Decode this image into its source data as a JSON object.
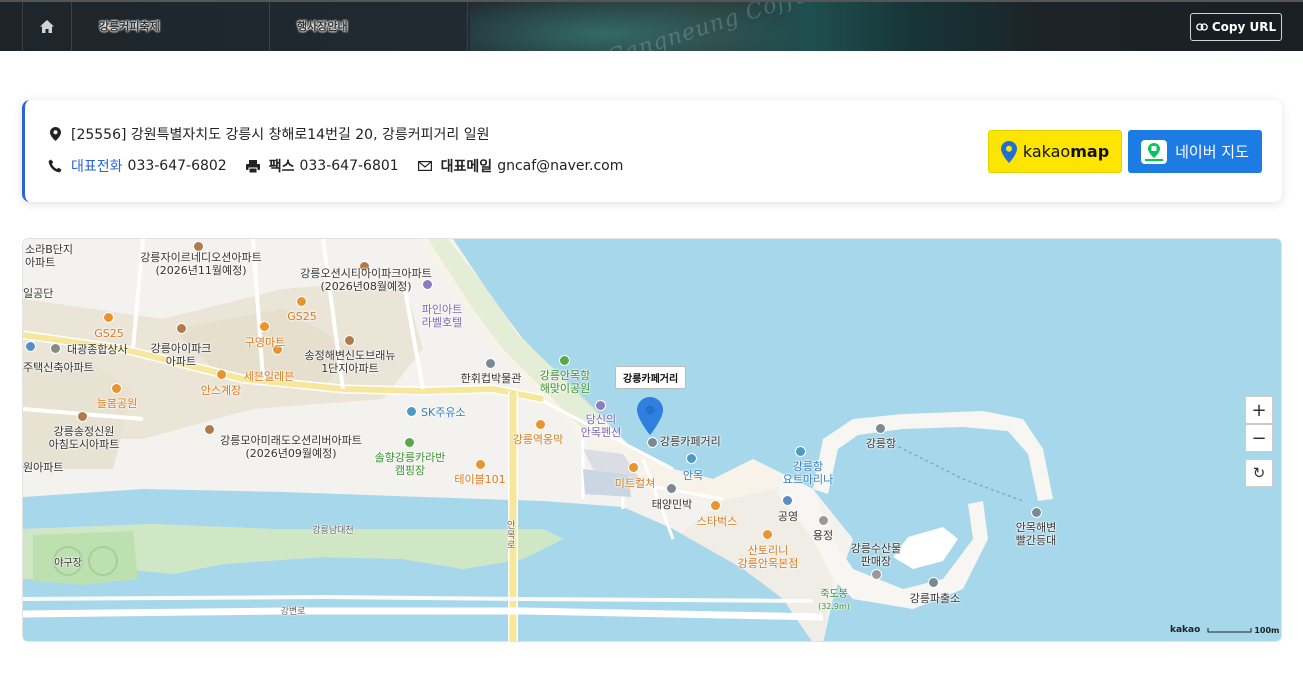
{
  "nav": {
    "festival_label": "강릉커피축제",
    "guide_label": "행사장안내",
    "copy_url_label": "Copy URL",
    "banner_text": "Gangneung Coffee Festival"
  },
  "info": {
    "address": "[25556] 강원특별자치도 강릉시 창해로14번길 20, 강릉커피거리 일원",
    "phone_label": "대표전화",
    "phone": "033-647-6802",
    "fax_label": "팩스",
    "fax": "033-647-6801",
    "email_label": "대표메일",
    "email": "gncaf@naver.com",
    "kakao_map_label_a": "kakao",
    "kakao_map_label_b": "map",
    "naver_map_label": "네이버 지도"
  },
  "map": {
    "marker_label": "강릉카페거리",
    "attribution": "kakao",
    "scale": "100m",
    "labels": {
      "sora": "소라B단지\n아파트",
      "ilgongdan": "일공단",
      "xi": "강릉자이르네디오션아파트\n(2026년11월예정)",
      "oceancity": "강릉오션시티아이파크아파트\n(2026년08월예정)",
      "pine": "파인아트\n라벨호텔",
      "gs25a": "GS25",
      "gs25b": "GS25",
      "daegwang": "대광종합상사",
      "ipark": "강릉아이파크\n아파트",
      "guyeong": "구영마트",
      "songjeong": "송정해변신도브래뉴\n1단지아파트",
      "jutaek": "주택신축아파트",
      "seben": "세븐일레븐",
      "anseu": "안스계장",
      "neulbom": "늘봄공원",
      "hanhwi": "한휘컵박물관",
      "haemaji": "강릉안목항\n해맞이공원",
      "dangsin": "당신의\n안목펜션",
      "sk": "SK주유소",
      "songjeongsin": "강릉송정신원\n아침도시아파트",
      "moamirae": "강릉모아미래도오션리버아파트\n(2026년09월예정)",
      "yeokmyeong": "강릉역옹막",
      "caravan": "솔향강릉카라반\n캠핑장",
      "table101": "테이블101",
      "cafe_street": "강릉카페거리",
      "anmok": "안목",
      "meat": "미트컬쳐",
      "taeyang": "태양민박",
      "starbucks": "스타벅스",
      "gangneunghang": "강릉항",
      "yacht": "강릉항\n요트마리나",
      "gongyeong": "공영",
      "yongjeong": "용정",
      "santorini": "산토리니\n강릉안목본점",
      "susan": "강릉수산물\n판매장",
      "jukdobong": "죽도봉",
      "jukdobong_height": "(32.9m)",
      "pachulso": "강릉파출소",
      "lighthouse": "안목해변\n빨간등대",
      "namdaecheon": "강릉남대천",
      "yagujang": "야구장",
      "gangbyeon": "강변로",
      "apt_left": "원아파트",
      "anmokro": "안목로"
    }
  },
  "colors": {
    "accent_blue": "#2d63d9",
    "kakao_yellow": "#fee500",
    "naver_blue": "#1d7ce3",
    "sea": "#a6d7ea",
    "river": "#a6d7ea"
  }
}
